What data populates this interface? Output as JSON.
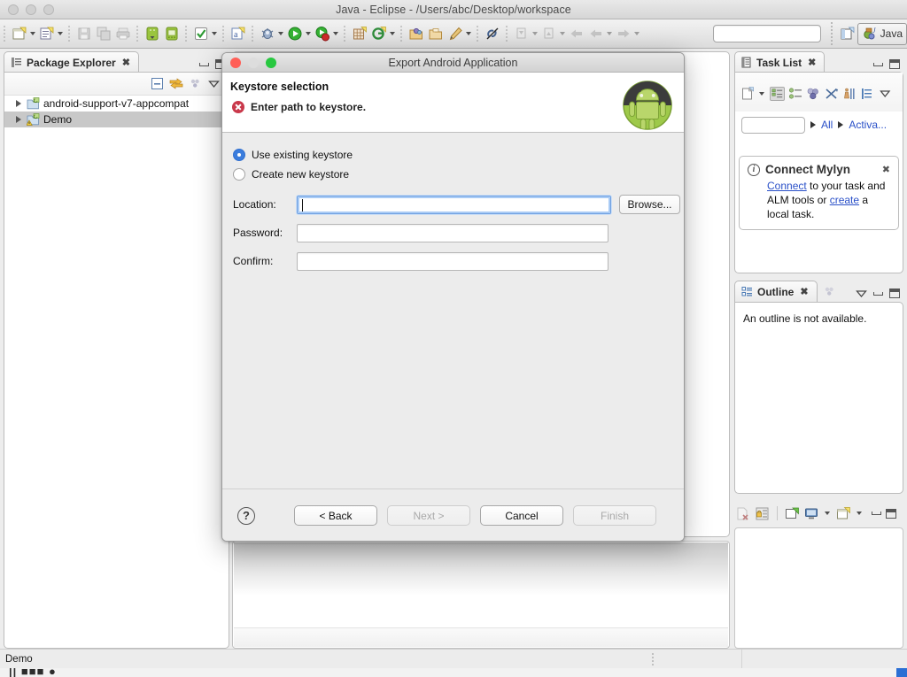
{
  "window": {
    "title": "Java - Eclipse - /Users/abc/Desktop/workspace"
  },
  "toolbar": {
    "search_placeholder": "",
    "search_value": "",
    "perspective_label": "Java",
    "icons": [
      "new-java-project-icon",
      "new-java-class-icon",
      "save-icon",
      "save-all-icon",
      "print-icon",
      "android-sdk-manager-icon",
      "android-avd-manager-icon",
      "check-icon",
      "new-annotation-icon",
      "debug-icon",
      "run-icon",
      "run-record-icon",
      "new-table-icon",
      "new-git-icon",
      "open-folder-icon",
      "open-package-icon",
      "pencil-icon",
      "link-break-icon",
      "next-annotation-icon",
      "previous-annotation-icon",
      "back-icon",
      "forward-back-icon",
      "forward-icon"
    ]
  },
  "package_explorer": {
    "tab_label": "Package Explorer",
    "toolbar_icons": [
      "collapse-all-icon",
      "link-with-editor-icon",
      "view-menu-dots-icon",
      "view-menu-icon"
    ],
    "items": [
      {
        "label": "android-support-v7-appcompat",
        "selected": false,
        "icon": "java-project-icon"
      },
      {
        "label": "Demo",
        "selected": true,
        "icon": "java-project-warning-icon"
      }
    ]
  },
  "task_list": {
    "tab_label": "Task List",
    "toolbar_icons": [
      "new-task-icon",
      "categorized-presentation-icon",
      "scheduled-presentation-icon",
      "focus-on-workweek-icon",
      "synchronize-changed-icon",
      "collapse-expand-icon",
      "view-menu-icon",
      "view-dropdown-icon"
    ],
    "filter_value": "",
    "links": [
      "All",
      "Activa..."
    ]
  },
  "connect_mylyn": {
    "title": "Connect Mylyn",
    "icon": "info-icon",
    "close_icon": "close-icon",
    "text_parts": {
      "link1": "Connect",
      "mid": " to your task and ALM tools or ",
      "link2": "create",
      "end": " a local task."
    }
  },
  "outline": {
    "tab_label": "Outline",
    "message": "An outline is not available."
  },
  "bottom_toolbar": {
    "icons": [
      "remove-launch-icon",
      "lock-console-icon",
      "open-console-icon",
      "display-selected-console-icon",
      "new-console-view-icon"
    ]
  },
  "status_bar": {
    "text": "Demo"
  },
  "dialog": {
    "title": "Export Android Application",
    "traffic_lights": [
      "close-button",
      "minimize-button",
      "zoom-button"
    ],
    "header": {
      "heading": "Keystore selection",
      "message": "Enter path to keystore.",
      "message_icon": "error-icon",
      "brand_icon": "android-robot-icon"
    },
    "options": [
      {
        "label": "Use existing keystore",
        "selected": true
      },
      {
        "label": "Create new keystore",
        "selected": false
      }
    ],
    "fields": [
      {
        "label": "Location:",
        "value": "",
        "focused": true,
        "has_browse": true
      },
      {
        "label": "Password:",
        "value": "",
        "focused": false,
        "has_browse": false
      },
      {
        "label": "Confirm:",
        "value": "",
        "focused": false,
        "has_browse": false
      }
    ],
    "browse_label": "Browse...",
    "help_icon_label": "?",
    "buttons": [
      {
        "label": "< Back",
        "enabled": true
      },
      {
        "label": "Next >",
        "enabled": false
      },
      {
        "label": "Cancel",
        "enabled": true
      },
      {
        "label": "Finish",
        "enabled": false
      }
    ]
  },
  "colors": {
    "accent_blue": "#3b7ddd",
    "link_blue": "#2a50c8",
    "error_red": "#c9384a",
    "android_green": "#a4c639",
    "selection_gray": "#c8c8c8"
  }
}
